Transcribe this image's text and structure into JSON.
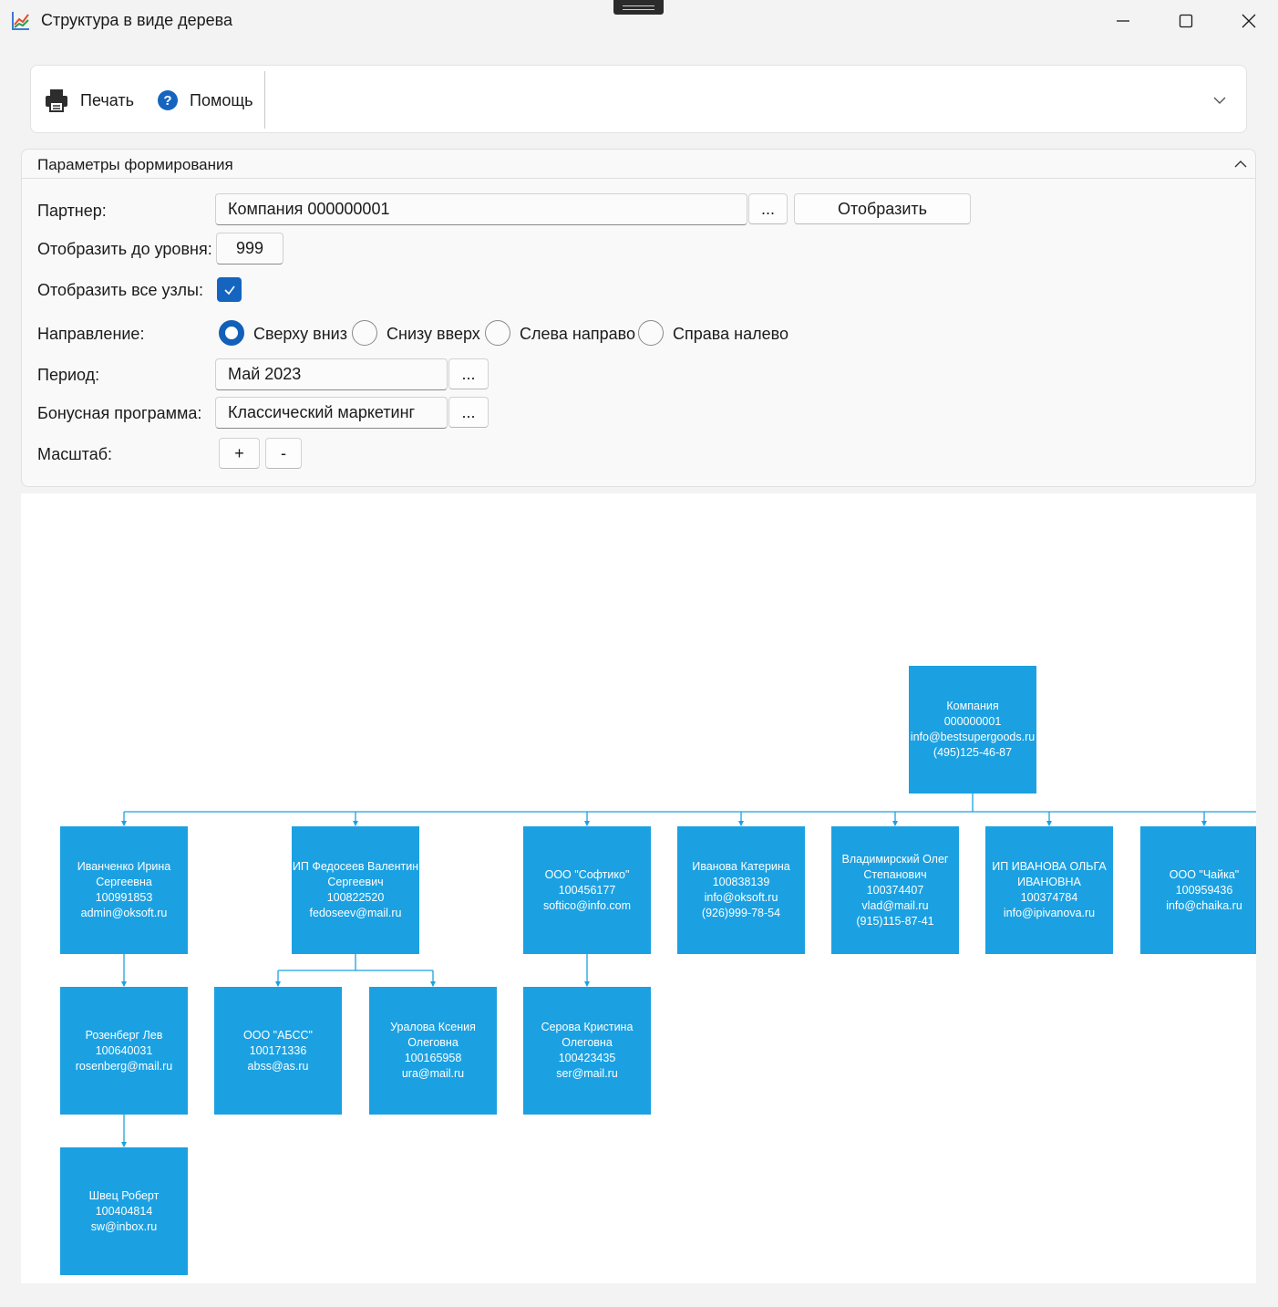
{
  "window": {
    "title": "Структура в виде дерева",
    "minimize_icon": "minimize-icon",
    "maximize_icon": "maximize-icon",
    "close_icon": "close-icon"
  },
  "ribbon": {
    "print_label": "Печать",
    "help_label": "Помощь",
    "print_icon": "printer-icon",
    "help_icon": "help-icon",
    "expand_icon": "chevron-down-icon"
  },
  "params": {
    "title": "Параметры формирования",
    "collapse_icon": "chevron-up-icon",
    "partner_label": "Партнер:",
    "partner_value": "Компания 000000001",
    "browse_label": "...",
    "show_button": "Отобразить",
    "level_label": "Отобразить до уровня:",
    "level_value": "999",
    "all_nodes_label": "Отобразить все узлы:",
    "all_nodes_checked": true,
    "direction_label": "Направление:",
    "directions": [
      {
        "label": "Сверху вниз",
        "selected": true
      },
      {
        "label": "Снизу вверх",
        "selected": false
      },
      {
        "label": "Слева направо",
        "selected": false
      },
      {
        "label": "Справа налево",
        "selected": false
      }
    ],
    "period_label": "Период:",
    "period_value": "Май 2023",
    "bonus_label": "Бонусная программа:",
    "bonus_value": "Классический маркетинг",
    "scale_label": "Масштаб:",
    "zoom_in_label": "+",
    "zoom_out_label": "-"
  },
  "tree": {
    "node_color": "#1ba1e2",
    "line_color": "#1ba1e2",
    "nodes": [
      {
        "id": "root",
        "parent": null,
        "lines": [
          "Компания",
          "000000001",
          "info@bestsupergoods.ru",
          "(495)125-46-87"
        ]
      },
      {
        "id": "n1",
        "parent": "root",
        "lines": [
          "Иванченко Ирина",
          "Сергеевна",
          "100991853",
          "admin@oksoft.ru"
        ]
      },
      {
        "id": "n2",
        "parent": "root",
        "lines": [
          "ИП Федосеев Валентин",
          "Сергеевич",
          "100822520",
          "fedoseev@mail.ru"
        ]
      },
      {
        "id": "n3",
        "parent": "root",
        "lines": [
          "ООО \"Софтико\"",
          "100456177",
          "softico@info.com"
        ]
      },
      {
        "id": "n4",
        "parent": "root",
        "lines": [
          "Иванова Катерина",
          "100838139",
          "info@oksoft.ru",
          "(926)999-78-54"
        ]
      },
      {
        "id": "n5",
        "parent": "root",
        "lines": [
          "Владимирский Олег",
          "Степанович",
          "100374407",
          "vlad@mail.ru",
          "(915)115-87-41"
        ]
      },
      {
        "id": "n6",
        "parent": "root",
        "lines": [
          "ИП ИВАНОВА ОЛЬГА",
          "ИВАНОВНА",
          "100374784",
          "info@ipivanova.ru"
        ]
      },
      {
        "id": "n7",
        "parent": "root",
        "lines": [
          "ООО \"Чайка\"",
          "100959436",
          "info@chaika.ru"
        ]
      },
      {
        "id": "n11",
        "parent": "n1",
        "lines": [
          "Розенберг Лев",
          "100640031",
          "rosenberg@mail.ru"
        ]
      },
      {
        "id": "n21",
        "parent": "n2",
        "lines": [
          "ООО \"АБСС\"",
          "100171336",
          "abss@as.ru"
        ]
      },
      {
        "id": "n22",
        "parent": "n2",
        "lines": [
          "Уралова Ксения",
          "Олеговна",
          "100165958",
          "ura@mail.ru"
        ]
      },
      {
        "id": "n31",
        "parent": "n3",
        "lines": [
          "Серова Кристина",
          "Олеговна",
          "100423435",
          "ser@mail.ru"
        ]
      },
      {
        "id": "n111",
        "parent": "n11",
        "lines": [
          "Швец Роберт",
          "100404814",
          "sw@inbox.ru"
        ]
      }
    ]
  }
}
